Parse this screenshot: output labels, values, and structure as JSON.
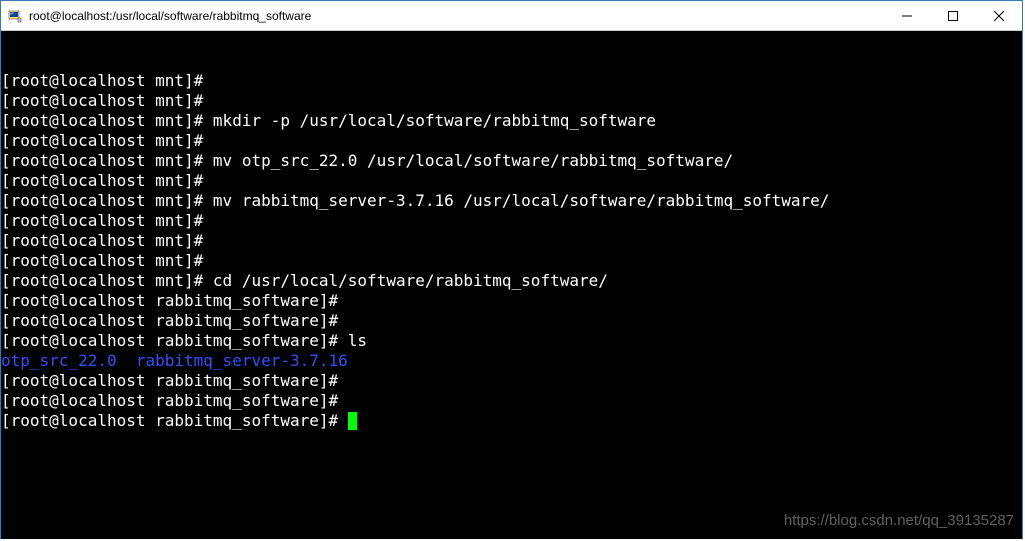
{
  "window": {
    "title": "root@localhost:/usr/local/software/rabbitmq_software"
  },
  "terminal": {
    "lines": [
      {
        "prompt": "[root@localhost mnt]#",
        "cmd": ""
      },
      {
        "prompt": "[root@localhost mnt]#",
        "cmd": ""
      },
      {
        "prompt": "[root@localhost mnt]#",
        "cmd": " mkdir -p /usr/local/software/rabbitmq_software"
      },
      {
        "prompt": "[root@localhost mnt]#",
        "cmd": ""
      },
      {
        "prompt": "[root@localhost mnt]#",
        "cmd": " mv otp_src_22.0 /usr/local/software/rabbitmq_software/"
      },
      {
        "prompt": "[root@localhost mnt]#",
        "cmd": ""
      },
      {
        "prompt": "[root@localhost mnt]#",
        "cmd": " mv rabbitmq_server-3.7.16 /usr/local/software/rabbitmq_software/"
      },
      {
        "prompt": "[root@localhost mnt]#",
        "cmd": ""
      },
      {
        "prompt": "[root@localhost mnt]#",
        "cmd": ""
      },
      {
        "prompt": "[root@localhost mnt]#",
        "cmd": ""
      },
      {
        "prompt": "[root@localhost mnt]#",
        "cmd": " cd /usr/local/software/rabbitmq_software/"
      },
      {
        "prompt": "[root@localhost rabbitmq_software]#",
        "cmd": ""
      },
      {
        "prompt": "[root@localhost rabbitmq_software]#",
        "cmd": ""
      },
      {
        "prompt": "[root@localhost rabbitmq_software]#",
        "cmd": " ls"
      }
    ],
    "ls_output": "otp_src_22.0  rabbitmq_server-3.7.16",
    "after_lines": [
      {
        "prompt": "[root@localhost rabbitmq_software]#",
        "cmd": ""
      },
      {
        "prompt": "[root@localhost rabbitmq_software]#",
        "cmd": ""
      }
    ],
    "cursor_line_prompt": "[root@localhost rabbitmq_software]# "
  },
  "watermark": "https://blog.csdn.net/qq_39135287"
}
